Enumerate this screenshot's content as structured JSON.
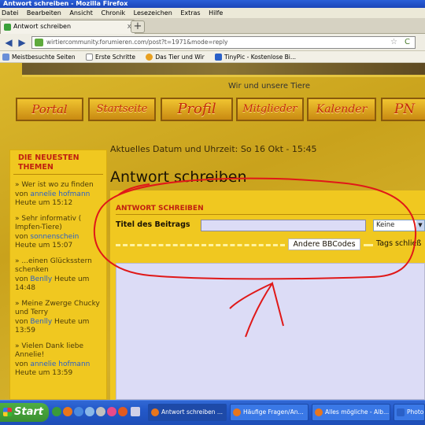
{
  "window": {
    "title": "Antwort schreiben - Mozilla Firefox"
  },
  "menu": [
    "Datei",
    "Bearbeiten",
    "Ansicht",
    "Chronik",
    "Lesezeichen",
    "Extras",
    "Hilfe"
  ],
  "tab": {
    "label": "Antwort schreiben",
    "close": "x",
    "new_tab": "+"
  },
  "nav": {
    "back": "◀",
    "forward": "▶",
    "url": "wirtiercommunity.forumieren.com/post?t=1971&mode=reply",
    "star": "☆",
    "reload": "C"
  },
  "bookmarks": [
    "Meistbesuchte Seiten",
    "Erste Schritte",
    "Das Tier und Wir",
    "TinyPic - Kostenlose Bi..."
  ],
  "site": {
    "subtitle": "Wir und unsere Tiere"
  },
  "site_nav": [
    "Portal",
    "Startseite",
    "Profil",
    "Mitglieder",
    "Kalender",
    "PN"
  ],
  "sidebar": {
    "heading": "DIE NEUESTEN THEMEN",
    "topics": [
      {
        "title": "» Wer ist wo zu finden",
        "by": "von",
        "user": "annelie hofmann",
        "time": "Heute um 15:12"
      },
      {
        "title": "» Sehr informativ ( Impfen-Tiere)",
        "by": "von",
        "user": "sonnenschein",
        "time": "Heute um 15:07"
      },
      {
        "title": "» ...einen Glücksstern schenken",
        "by": "von",
        "user": "Benlly",
        "time": "Heute um 14:48"
      },
      {
        "title": "» Meine Zwerge Chucky und Terry",
        "by": "von",
        "user": "Benlly",
        "time": "Heute um 13:59"
      },
      {
        "title": "» Vielen Dank liebe Annelie!",
        "by": "von",
        "user": "annelie hofmann",
        "time": "Heute um 13:59"
      }
    ]
  },
  "main": {
    "datetime": "Aktuelles Datum und Uhrzeit: So 16 Okt - 15:45",
    "heading": "Antwort schreiben",
    "form_heading": "ANTWORT SCHREIBEN",
    "title_label": "Titel des Beitrags",
    "title_value": "",
    "select_value": "Keine",
    "bbcodes_button": "Andere BBCodes",
    "tags_label": "Tags schließ"
  },
  "annotation": {
    "color": "#e01818"
  },
  "taskbar": {
    "start": "Start",
    "tasks": [
      "Antwort schreiben ...",
      "Häufige Fragen/An...",
      "Alles mögliche - Alb...",
      "Photo..."
    ]
  },
  "colors": {
    "accent": "#c02010",
    "panel": "#f0c820",
    "link": "#2a60c8"
  }
}
